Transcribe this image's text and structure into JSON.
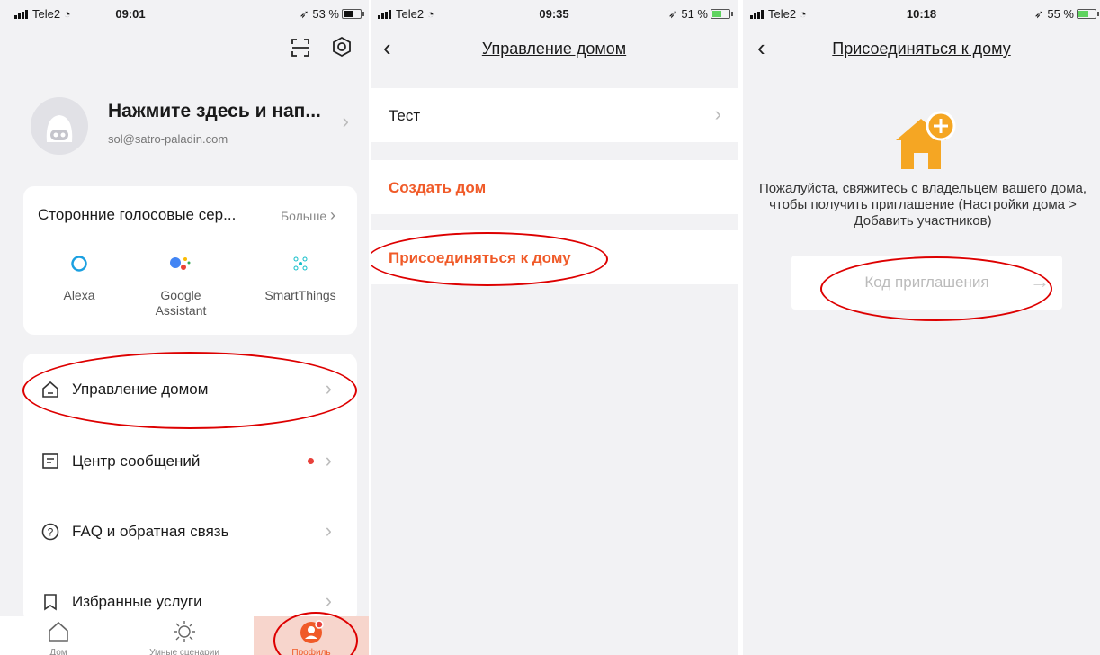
{
  "screens": [
    {
      "status": {
        "carrier": "Tele2",
        "time": "09:01",
        "battery": "53 %"
      },
      "profile": {
        "name": "Нажмите здесь и нап...",
        "email": "sol@satro-paladin.com"
      },
      "voice": {
        "title": "Сторонние голосовые сер...",
        "more": "Больше",
        "services": [
          {
            "label": "Alexa"
          },
          {
            "label": "Google\nAssistant"
          },
          {
            "label": "SmartThings"
          }
        ]
      },
      "menu": [
        {
          "label": "Управление домом",
          "icon": "house-icon"
        },
        {
          "label": "Центр сообщений",
          "icon": "message-icon"
        },
        {
          "label": "FAQ и обратная связь",
          "icon": "question-icon"
        },
        {
          "label": "Избранные услуги",
          "icon": "bookmark-icon"
        }
      ],
      "tabs": [
        {
          "label": "Дом"
        },
        {
          "label": "Умные сценарии"
        },
        {
          "label": "Профиль"
        }
      ]
    },
    {
      "status": {
        "carrier": "Tele2",
        "time": "09:35",
        "battery": "51 %"
      },
      "title": "Управление домом",
      "homes": [
        {
          "label": "Тест"
        }
      ],
      "create": "Создать дом",
      "join": "Присоединяться к дому"
    },
    {
      "status": {
        "carrier": "Tele2",
        "time": "10:18",
        "battery": "55 %"
      },
      "title": "Присоединяться к дому",
      "message": "Пожалуйста, свяжитесь с владельцем вашего дома, чтобы получить приглашение (Настройки дома > Добавить участников)",
      "code_placeholder": "Код приглашения"
    }
  ],
  "colors": {
    "accent": "#f05a28",
    "house": "#f5a623",
    "annotation": "#dd0000"
  }
}
